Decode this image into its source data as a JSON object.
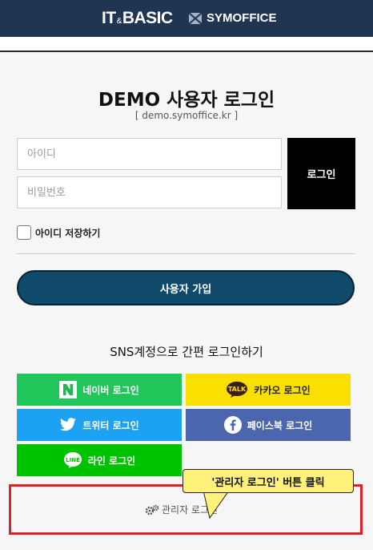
{
  "header": {
    "brand_left": "IT",
    "brand_amp": "&",
    "brand_right": "BASIC",
    "brand2": "SYMOFFICE"
  },
  "login": {
    "title": "DEMO 사용자 로그인",
    "subtitle": "[ demo.symoffice.kr ]",
    "id_placeholder": "아이디",
    "password_placeholder": "비밀번호",
    "login_button": "로그인",
    "remember_label": "아이디 저장하기",
    "signup_button": "사용자 가입"
  },
  "sns": {
    "title": "SNS계정으로 간편 로그인하기",
    "buttons": [
      {
        "label": "네이버 로그인",
        "color": "#21c65a",
        "icon": "naver-icon"
      },
      {
        "label": "카카오 로그인",
        "color": "#f9e000",
        "icon": "kakao-talk-icon"
      },
      {
        "label": "트위터 로그인",
        "color": "#1da1f2",
        "icon": "twitter-icon"
      },
      {
        "label": "페이스북 로그인",
        "color": "#4a66ad",
        "icon": "facebook-icon"
      },
      {
        "label": "라인 로그인",
        "color": "#00c300",
        "icon": "line-icon"
      }
    ]
  },
  "admin": {
    "label": "관리자 로그인",
    "icon": "gears-icon"
  },
  "annotation": {
    "callout_text": "'관리자 로그인' 버튼 클릭",
    "box_color": "#e02127",
    "callout_color": "#fff27a"
  }
}
